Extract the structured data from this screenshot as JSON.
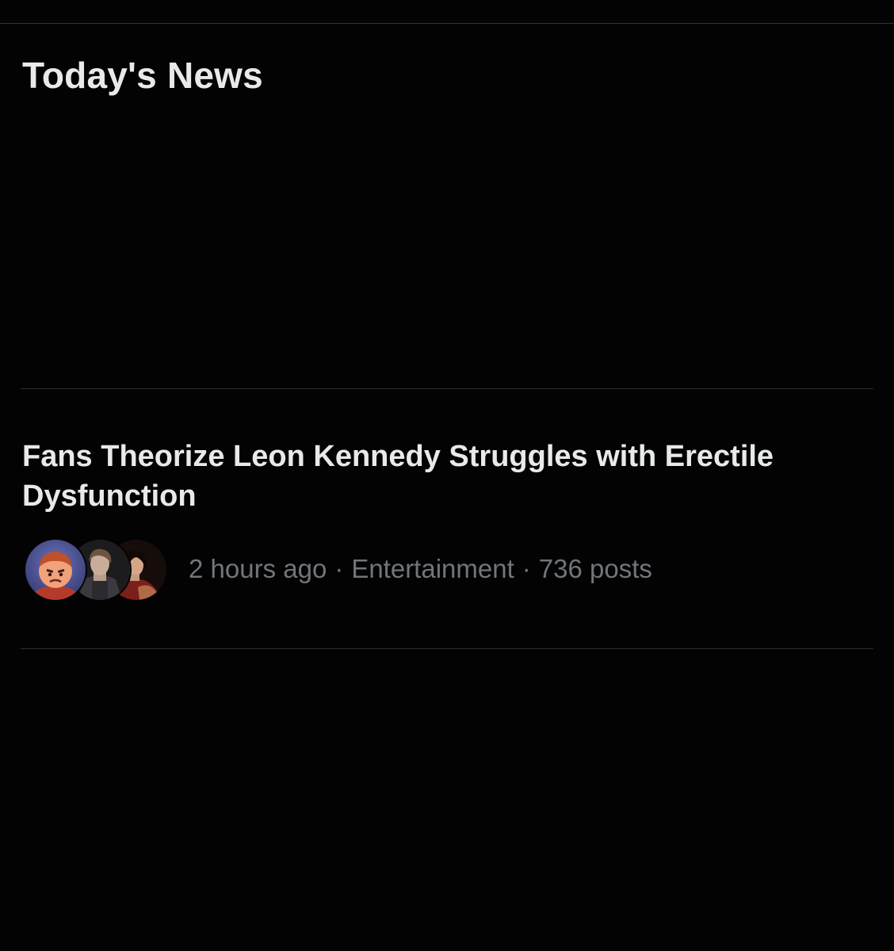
{
  "section": {
    "title": "Today's News"
  },
  "news_items": [
    {
      "headline": "Fans Theorize Leon Kennedy Struggles with Erectile Dysfunction",
      "time": "2 hours ago",
      "category": "Entertainment",
      "posts": "736 posts",
      "separator": "·",
      "avatars": [
        "avatar-cartoon-boy",
        "avatar-leon-kennedy",
        "avatar-ada-wong"
      ]
    }
  ],
  "colors": {
    "background": "#030304",
    "text_primary": "#e7e9ea",
    "text_secondary": "#71767b",
    "divider": "#2f3336"
  }
}
